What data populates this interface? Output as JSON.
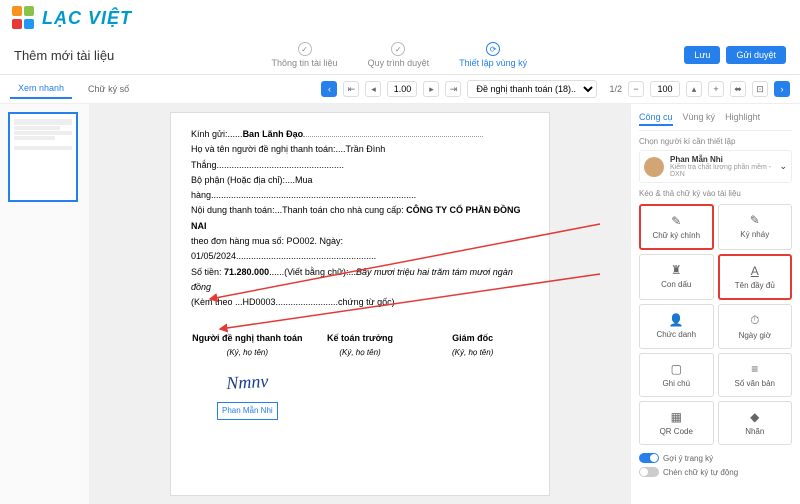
{
  "brand": "LẠC VIỆT",
  "title": "Thêm mới tài liệu",
  "header_tabs": [
    {
      "label": "Thông tin tài liệu"
    },
    {
      "label": "Quy trình duyệt"
    },
    {
      "label": "Thiết lập vùng ký",
      "active": true
    }
  ],
  "buttons": {
    "save": "Lưu",
    "submit": "Gửi duyệt"
  },
  "sub_tabs": [
    {
      "label": "Xem nhanh",
      "active": true
    },
    {
      "label": "Chữ ký số"
    }
  ],
  "toolbar": {
    "page_input": "1.00",
    "doc_select": "Đề nghị thanh toán (18)....",
    "page_info": "1/2",
    "zoom": "100"
  },
  "document": {
    "line1_pre": "Kính gửi:......",
    "line1_bold": "Ban Lãnh Đạo",
    "line2": "Họ và tên người đề nghị thanh toán:....Trần Đình Thắng",
    "dots": "...................................................",
    "line3": "Bộ phận (Hoặc địa chỉ):....Mua hàng",
    "dots3": "..................................................................................",
    "line4_pre": "Nội dung thanh toán:...Thanh toán   cho nhà cung cấp: ",
    "line4_bold": "CÔNG TY CỔ PHẦN ĐỒNG NAI",
    "line5": "theo đơn hàng mua số: PO002. Ngày: 01/05/2024",
    "dots5": "........................................................",
    "line6_pre": "Số tiền: ",
    "line6_bold": "71.280.000",
    "line6_mid": "......(Viết bằng chữ):...",
    "line6_it": "Bảy mươi triệu hai trăm tám mươi ngàn đồng",
    "line7": "(Kèm theo ...HD0003.........................chứng từ gốc)",
    "sig1": {
      "t": "Người đề nghị thanh toán",
      "s": "(Ký, họ tên)"
    },
    "sig2": {
      "t": "Kế toán trưởng",
      "s": "(Ký, họ tên)"
    },
    "sig3": {
      "t": "Giám đốc",
      "s": "(Ký, họ tên)"
    },
    "name_box": "Phan Mẫn Nhi"
  },
  "side": {
    "tabs": [
      {
        "label": "Công cụ",
        "active": true
      },
      {
        "label": "Vùng ký"
      },
      {
        "label": "Highlight"
      }
    ],
    "signer_label": "Chọn người kí cần thiết lập",
    "signer": {
      "name": "Phan Mẫn Nhi",
      "role": "Kiểm tra chất lượng phần mềm - DXN"
    },
    "drag_label": "Kéo & thả chữ ký vào tài liệu",
    "tools": [
      {
        "icon": "✎",
        "label": "Chữ ký chính",
        "hl": true
      },
      {
        "icon": "✎",
        "label": "Ký nháy"
      },
      {
        "icon": "♜",
        "label": "Con dấu"
      },
      {
        "icon": "A",
        "label": "Tên đầy đủ",
        "hl": true,
        "underline": true
      },
      {
        "icon": "👤",
        "label": "Chức danh"
      },
      {
        "icon": "⏱",
        "label": "Ngày giờ"
      },
      {
        "icon": "▢",
        "label": "Ghi chú"
      },
      {
        "icon": "≡",
        "label": "Số văn bản"
      },
      {
        "icon": "▦",
        "label": "QR Code"
      },
      {
        "icon": "◆",
        "label": "Nhãn"
      }
    ],
    "toggle1": "Gợi ý trang ký",
    "toggle2": "Chèn chữ ký tự động"
  }
}
